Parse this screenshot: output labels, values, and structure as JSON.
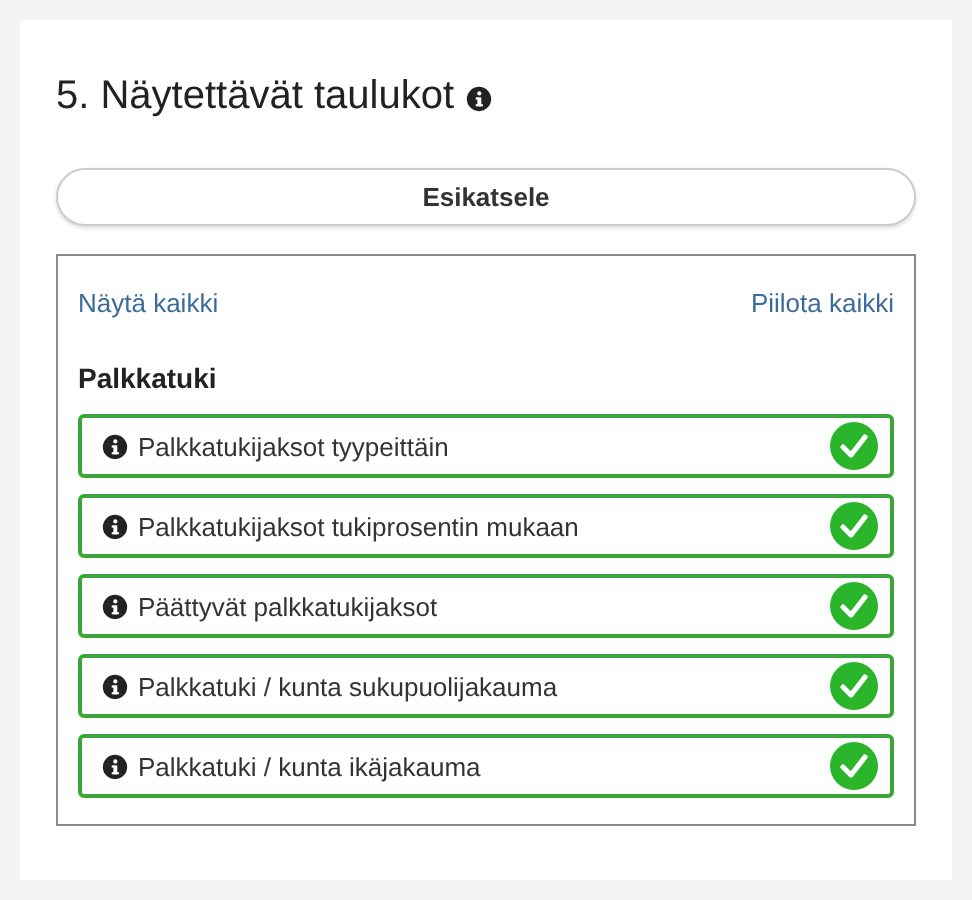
{
  "section": {
    "title": "5. Näytettävät taulukot"
  },
  "preview_button": "Esikatsele",
  "panel": {
    "show_all": "Näytä kaikki",
    "hide_all": "Piilota kaikki",
    "group": "Palkkatuki",
    "items": [
      {
        "label": "Palkkatukijaksot tyypeittäin",
        "checked": true
      },
      {
        "label": "Palkkatukijaksot tukiprosentin mukaan",
        "checked": true
      },
      {
        "label": "Päättyvät palkkatukijaksot",
        "checked": true
      },
      {
        "label": "Palkkatuki / kunta sukupuolijakauma",
        "checked": true
      },
      {
        "label": "Palkkatuki / kunta ikäjakauma",
        "checked": true
      }
    ]
  }
}
